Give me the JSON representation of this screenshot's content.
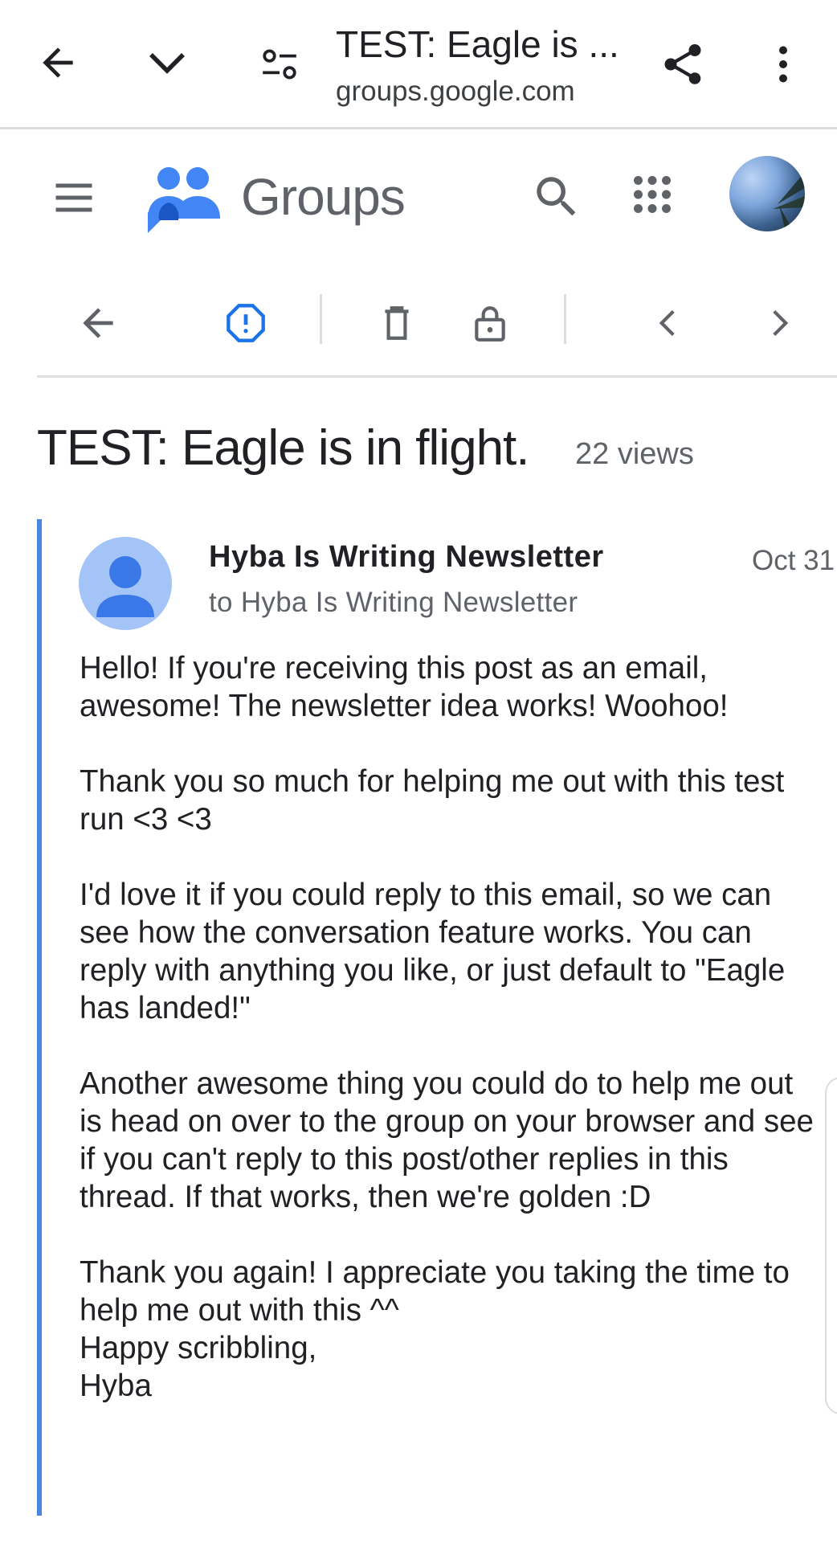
{
  "browser": {
    "tab_title": "TEST: Eagle is ...",
    "url": "groups.google.com",
    "icons": {
      "back": "arrow-left-icon",
      "collapse": "chevron-down-icon",
      "site_settings": "tune-icon",
      "share": "share-icon",
      "more": "more-vert-icon"
    }
  },
  "app": {
    "name": "Groups",
    "icons": {
      "menu": "hamburger-icon",
      "logo": "groups-logo-icon",
      "search": "search-icon",
      "apps": "apps-grid-icon",
      "account": "avatar"
    },
    "brand_color": "#4285f4"
  },
  "toolbar": {
    "icons": [
      "arrow-left-icon",
      "report-icon",
      "delete-icon",
      "lock-icon",
      "chevron-left-icon",
      "chevron-right-icon"
    ]
  },
  "post": {
    "title": "TEST: Eagle is in flight.",
    "views": "22 views"
  },
  "message": {
    "sender": "Hyba Is Writing Newsletter",
    "recipients": "to Hyba Is Writing Newsletter",
    "date": "Oct 31",
    "accent_color": "#4a86e0",
    "paragraphs": [
      "Hello! If you're receiving this post as an email, awesome! The newsletter idea works! Woohoo!",
      "Thank you so much for helping me out with this test run <3 <3",
      "I'd love it if you could reply to this email, so we can see how the conversation feature works. You can reply with anything you like, or just default to \"Eagle has landed!\"",
      "Another awesome thing you could do to help me out is head on over to the group on your browser and see if you can't reply to this post/other replies in this thread. If that works, then we're golden :D"
    ],
    "closing": {
      "line1": "Thank you again! I appreciate you taking the time to help me out with this ^^",
      "line2": "Happy scribbling,",
      "line3": "Hyba"
    }
  }
}
